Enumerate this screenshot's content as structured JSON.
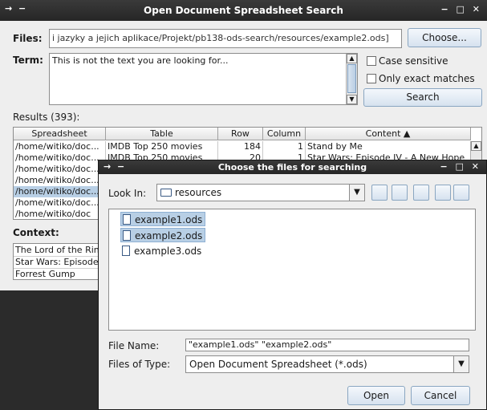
{
  "main_window": {
    "title": "Open Document Spreadsheet Search",
    "title_left_controls": "→ −",
    "title_right_controls": "− □ ✕",
    "files_label": "Files:",
    "files_value": "i jazyky a jejich aplikace/Projekt/pb138-ods-search/resources/example2.ods]",
    "choose_button": "Choose...",
    "term_label": "Term:",
    "term_value": "This is not the text you are looking for...",
    "case_sensitive_label": "Case sensitive",
    "exact_matches_label": "Only exact matches",
    "search_button": "Search",
    "results_label": "Results (393):",
    "table": {
      "columns": [
        "Spreadsheet",
        "Table",
        "Row",
        "Column",
        "Content ▲"
      ],
      "rows": [
        [
          "/home/witiko/doc...",
          "IMDB Top 250 movies",
          "184",
          "1",
          "Stand by Me"
        ],
        [
          "/home/witiko/doc...",
          "IMDB Top 250 movies",
          "20",
          "1",
          "Star Wars: Episode IV - A New Hope"
        ],
        [
          "/home/witiko/doc...",
          "",
          "",
          "",
          ""
        ],
        [
          "/home/witiko/doc...",
          "",
          "",
          "",
          ""
        ],
        [
          "/home/witiko/doc...",
          "",
          "",
          "",
          ""
        ],
        [
          "/home/witiko/doc...",
          "",
          "",
          "",
          ""
        ],
        [
          "/home/witiko/doc",
          "",
          "",
          "",
          ""
        ]
      ]
    },
    "context_label": "Context:",
    "context_rows": [
      "The Lord of the Rin",
      "Star Wars: Episode",
      "Forrest Gump"
    ]
  },
  "dialog": {
    "title": "Choose the files for searching",
    "title_left_controls": "→ −",
    "title_right_controls": "− □ ✕",
    "look_in_label": "Look In:",
    "look_in_value": "resources",
    "files": [
      {
        "name": "example1.ods",
        "selected": true
      },
      {
        "name": "example2.ods",
        "selected": true
      },
      {
        "name": "example3.ods",
        "selected": false
      }
    ],
    "file_name_label": "File Name:",
    "file_name_value": "\"example1.ods\" \"example2.ods\"",
    "files_of_type_label": "Files of Type:",
    "files_of_type_value": "Open Document Spreadsheet (*.ods)",
    "open_button": "Open",
    "cancel_button": "Cancel"
  }
}
